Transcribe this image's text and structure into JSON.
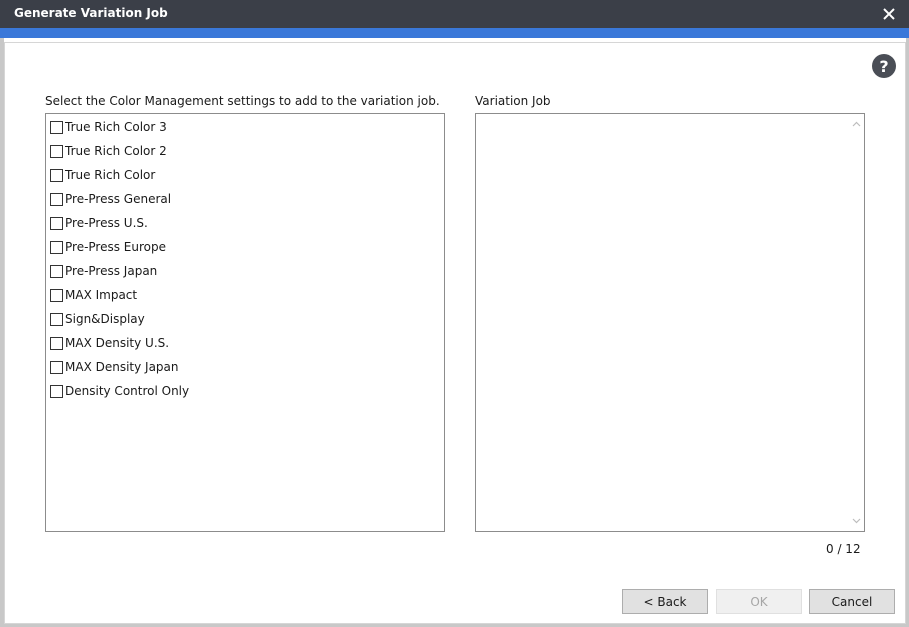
{
  "window": {
    "title": "Generate Variation Job",
    "close_icon": "close-icon",
    "help_icon": "help-icon",
    "help_glyph": "?"
  },
  "left_panel": {
    "label": "Select the Color Management settings to add to the variation job.",
    "items": [
      {
        "label": "True Rich Color 3",
        "checked": false
      },
      {
        "label": "True Rich Color 2",
        "checked": false
      },
      {
        "label": "True Rich Color",
        "checked": false
      },
      {
        "label": "Pre-Press General",
        "checked": false
      },
      {
        "label": "Pre-Press U.S.",
        "checked": false
      },
      {
        "label": "Pre-Press Europe",
        "checked": false
      },
      {
        "label": "Pre-Press Japan",
        "checked": false
      },
      {
        "label": "MAX Impact",
        "checked": false
      },
      {
        "label": "Sign&Display",
        "checked": false
      },
      {
        "label": "MAX Density U.S.",
        "checked": false
      },
      {
        "label": "MAX Density Japan",
        "checked": false
      },
      {
        "label": "Density Control Only",
        "checked": false
      }
    ]
  },
  "right_panel": {
    "label": "Variation Job",
    "items": []
  },
  "counter": "0 / 12",
  "buttons": {
    "back": "< Back",
    "ok": "OK",
    "cancel": "Cancel"
  },
  "colors": {
    "titlebar": "#3b3f48",
    "accent": "#3a78d9",
    "disabled_text": "#a6a6a6"
  }
}
